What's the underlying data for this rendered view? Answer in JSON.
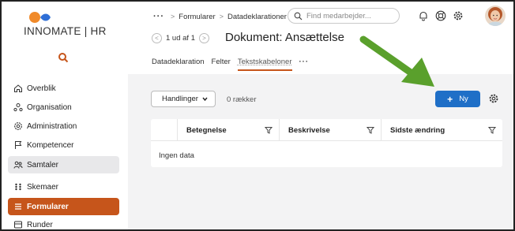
{
  "brand": {
    "name": "INNOMATE | HR",
    "color_orange": "#f08a2a",
    "color_blue": "#2f6fd6"
  },
  "sidebar": {
    "search_icon": "search-icon",
    "items": [
      {
        "label": "Overblik",
        "icon": "home-icon"
      },
      {
        "label": "Organisation",
        "icon": "org-icon"
      },
      {
        "label": "Administration",
        "icon": "admin-gear-icon"
      },
      {
        "label": "Kompetencer",
        "icon": "flag-icon"
      },
      {
        "label": "Samtaler",
        "icon": "people-icon"
      },
      {
        "label": "Skemaer",
        "icon": "grid-dots-icon"
      },
      {
        "label": "Formularer",
        "icon": "list-icon"
      },
      {
        "label": "Runder",
        "icon": "rounds-icon"
      }
    ],
    "accent": "#c6551b"
  },
  "header": {
    "breadcrumbs": [
      "Formularer",
      "Datadeklarationer"
    ],
    "search_placeholder": "Find medarbejder...",
    "pager": "1 ud af 1",
    "title": "Dokument: Ansættelse",
    "tabs": [
      "Datadeklaration",
      "Felter",
      "Tekstskabeloner"
    ],
    "active_tab": "Tekstskabeloner"
  },
  "content": {
    "actions_label": "Handlinger",
    "rows_count": "0 rækker",
    "new_button": "Ny",
    "columns": [
      "Betegnelse",
      "Beskrivelse",
      "Sidste ændring"
    ],
    "empty_text": "Ingen data",
    "primary_color": "#1f6fc7",
    "arrow_color": "#5aa02c"
  }
}
